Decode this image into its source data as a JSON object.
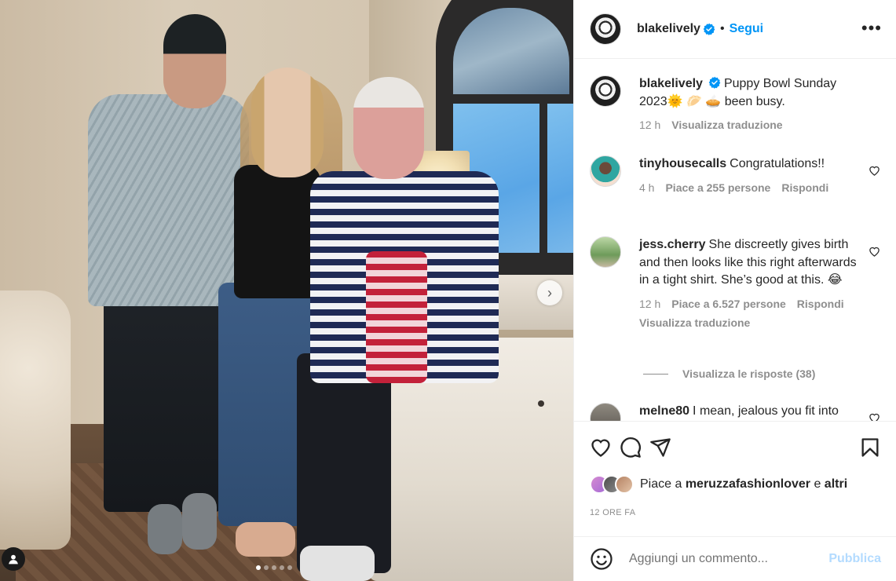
{
  "post": {
    "username": "blakelively",
    "follow_label": "Segui",
    "more_label": "•••",
    "caption": "Puppy Bowl Sunday 2023🌞 🥟 🥧 been busy.",
    "caption_time": "12 h",
    "caption_translate": "Visualizza traduzione",
    "carousel": {
      "slides": 5,
      "active": 0
    }
  },
  "comments": [
    {
      "username": "tinyhousecalls",
      "text": "Congratulations!!",
      "time": "4 h",
      "likes": "Piace a 255 persone",
      "reply": "Rispondi"
    },
    {
      "username": "jess.cherry",
      "text": "She discreetly gives birth and then looks like this right afterwards in a tight shirt. She’s good at this. 😂",
      "time": "12 h",
      "likes": "Piace a 6.527 persone",
      "reply": "Rispondi",
      "translate": "Visualizza traduzione"
    },
    {
      "username": "melne80",
      "text": "I mean, jealous you fit into"
    }
  ],
  "replies_label": "Visualizza le risposte (38)",
  "likes_line": {
    "prefix": "Piace a",
    "user": "meruzzafashionlover",
    "joiner": "e",
    "others": "altri"
  },
  "timestamp": "12 ORE FA",
  "add_comment": {
    "placeholder": "Aggiungi un commento...",
    "publish": "Pubblica"
  },
  "colors": {
    "accent": "#0095f6",
    "publish_disabled": "#b3dbff",
    "text": "#262626",
    "muted": "#8e8e8e"
  },
  "icons": [
    "heart-icon",
    "comment-icon",
    "share-icon",
    "bookmark-icon",
    "emoji-icon",
    "verified-icon",
    "chevron-right-icon",
    "user-tag-icon"
  ]
}
